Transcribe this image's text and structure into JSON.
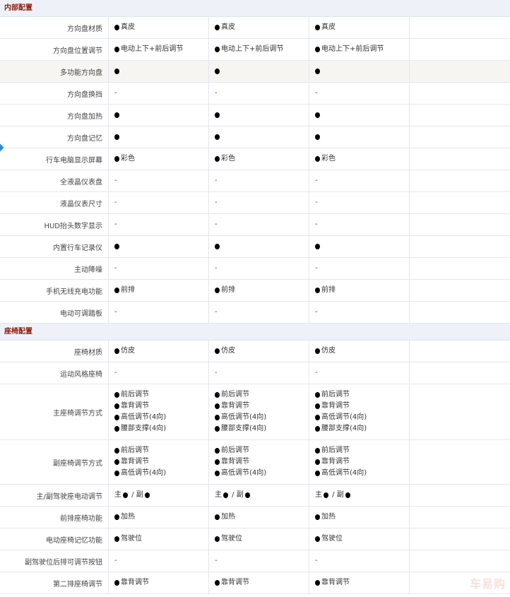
{
  "watermark": "车易购",
  "sections": [
    {
      "title": "内部配置",
      "rows": [
        {
          "label": "方向盘材质",
          "cells": [
            [
              {
                "dot": true,
                "text": "真皮"
              }
            ],
            [
              {
                "dot": true,
                "text": "真皮"
              }
            ],
            [
              {
                "dot": true,
                "text": "真皮"
              }
            ],
            []
          ]
        },
        {
          "label": "方向盘位置调节",
          "cells": [
            [
              {
                "dot": true,
                "text": "电动上下+前后调节"
              }
            ],
            [
              {
                "dot": true,
                "text": "电动上下+前后调节"
              }
            ],
            [
              {
                "dot": true,
                "text": "电动上下+前后调节"
              }
            ],
            []
          ]
        },
        {
          "label": "多功能方向盘",
          "highlight": true,
          "cells": [
            [
              {
                "dot": true,
                "text": ""
              }
            ],
            [
              {
                "dot": true,
                "text": ""
              }
            ],
            [
              {
                "dot": true,
                "text": ""
              }
            ],
            []
          ]
        },
        {
          "label": "方向盘换挡",
          "cells": [
            [
              {
                "dot": false,
                "text": "-"
              }
            ],
            [
              {
                "dot": false,
                "text": "-"
              }
            ],
            [
              {
                "dot": false,
                "text": "-"
              }
            ],
            []
          ]
        },
        {
          "label": "方向盘加热",
          "cells": [
            [
              {
                "dot": true,
                "text": ""
              }
            ],
            [
              {
                "dot": true,
                "text": ""
              }
            ],
            [
              {
                "dot": true,
                "text": ""
              }
            ],
            []
          ]
        },
        {
          "label": "方向盘记忆",
          "cells": [
            [
              {
                "dot": true,
                "text": ""
              }
            ],
            [
              {
                "dot": true,
                "text": ""
              }
            ],
            [
              {
                "dot": true,
                "text": ""
              }
            ],
            []
          ]
        },
        {
          "label": "行车电脑显示屏幕",
          "cells": [
            [
              {
                "dot": true,
                "text": "彩色"
              }
            ],
            [
              {
                "dot": true,
                "text": "彩色"
              }
            ],
            [
              {
                "dot": true,
                "text": "彩色"
              }
            ],
            []
          ]
        },
        {
          "label": "全液晶仪表盘",
          "cells": [
            [
              {
                "dot": false,
                "text": "-"
              }
            ],
            [
              {
                "dot": false,
                "text": "-"
              }
            ],
            [
              {
                "dot": false,
                "text": "-"
              }
            ],
            []
          ]
        },
        {
          "label": "液晶仪表尺寸",
          "cells": [
            [
              {
                "dot": false,
                "text": "-"
              }
            ],
            [
              {
                "dot": false,
                "text": "-"
              }
            ],
            [
              {
                "dot": false,
                "text": "-"
              }
            ],
            []
          ]
        },
        {
          "label": "HUD抬头数字显示",
          "cells": [
            [
              {
                "dot": false,
                "text": "-"
              }
            ],
            [
              {
                "dot": false,
                "text": "-"
              }
            ],
            [
              {
                "dot": false,
                "text": "-"
              }
            ],
            []
          ]
        },
        {
          "label": "内置行车记录仪",
          "cells": [
            [
              {
                "dot": true,
                "text": ""
              }
            ],
            [
              {
                "dot": true,
                "text": ""
              }
            ],
            [
              {
                "dot": true,
                "text": ""
              }
            ],
            []
          ]
        },
        {
          "label": "主动降噪",
          "cells": [
            [
              {
                "dot": false,
                "text": "-"
              }
            ],
            [
              {
                "dot": false,
                "text": "-"
              }
            ],
            [
              {
                "dot": false,
                "text": "-"
              }
            ],
            []
          ]
        },
        {
          "label": "手机无线充电功能",
          "cells": [
            [
              {
                "dot": true,
                "text": "前排"
              }
            ],
            [
              {
                "dot": true,
                "text": "前排"
              }
            ],
            [
              {
                "dot": true,
                "text": "前排"
              }
            ],
            []
          ]
        },
        {
          "label": "电动可调踏板",
          "cells": [
            [
              {
                "dot": false,
                "text": "-"
              }
            ],
            [
              {
                "dot": false,
                "text": "-"
              }
            ],
            [
              {
                "dot": false,
                "text": "-"
              }
            ],
            []
          ]
        }
      ]
    },
    {
      "title": "座椅配置",
      "rows": [
        {
          "label": "座椅材质",
          "cells": [
            [
              {
                "dot": true,
                "text": "仿皮"
              }
            ],
            [
              {
                "dot": true,
                "text": "仿皮"
              }
            ],
            [
              {
                "dot": true,
                "text": "仿皮"
              }
            ],
            []
          ]
        },
        {
          "label": "运动风格座椅",
          "cells": [
            [
              {
                "dot": false,
                "text": "-"
              }
            ],
            [
              {
                "dot": false,
                "text": "-"
              }
            ],
            [
              {
                "dot": false,
                "text": "-"
              }
            ],
            []
          ]
        },
        {
          "label": "主座椅调节方式",
          "height": 79,
          "cells": [
            [
              {
                "dot": true,
                "text": "前后调节"
              },
              {
                "dot": true,
                "text": "靠背调节"
              },
              {
                "dot": true,
                "text": "高低调节(4向)"
              },
              {
                "dot": true,
                "text": "腰部支撑(4向)"
              }
            ],
            [
              {
                "dot": true,
                "text": "前后调节"
              },
              {
                "dot": true,
                "text": "靠背调节"
              },
              {
                "dot": true,
                "text": "高低调节(4向)"
              },
              {
                "dot": true,
                "text": "腰部支撑(4向)"
              }
            ],
            [
              {
                "dot": true,
                "text": "前后调节"
              },
              {
                "dot": true,
                "text": "靠背调节"
              },
              {
                "dot": true,
                "text": "高低调节(4向)"
              },
              {
                "dot": true,
                "text": "腰部支撑(4向)"
              }
            ],
            []
          ]
        },
        {
          "label": "副座椅调节方式",
          "height": 63,
          "cells": [
            [
              {
                "dot": true,
                "text": "前后调节"
              },
              {
                "dot": true,
                "text": "靠背调节"
              },
              {
                "dot": true,
                "text": "高低调节(4向)"
              }
            ],
            [
              {
                "dot": true,
                "text": "前后调节"
              },
              {
                "dot": true,
                "text": "靠背调节"
              },
              {
                "dot": true,
                "text": "高低调节(4向)"
              }
            ],
            [
              {
                "dot": true,
                "text": "前后调节"
              },
              {
                "dot": true,
                "text": "靠背调节"
              },
              {
                "dot": true,
                "text": "高低调节(4向)"
              }
            ],
            []
          ]
        },
        {
          "label": "主/副驾驶座电动调节",
          "cells": [
            [
              {
                "pair": true,
                "a": "主",
                "sep": " / ",
                "b": "副"
              }
            ],
            [
              {
                "pair": true,
                "a": "主",
                "sep": " / ",
                "b": "副"
              }
            ],
            [
              {
                "pair": true,
                "a": "主",
                "sep": " / ",
                "b": "副"
              }
            ],
            []
          ]
        },
        {
          "label": "前排座椅功能",
          "cells": [
            [
              {
                "dot": true,
                "text": "加热"
              }
            ],
            [
              {
                "dot": true,
                "text": "加热"
              }
            ],
            [
              {
                "dot": true,
                "text": "加热"
              }
            ],
            []
          ]
        },
        {
          "label": "电动座椅记忆功能",
          "cells": [
            [
              {
                "dot": true,
                "text": "驾驶位"
              }
            ],
            [
              {
                "dot": true,
                "text": "驾驶位"
              }
            ],
            [
              {
                "dot": true,
                "text": "驾驶位"
              }
            ],
            []
          ]
        },
        {
          "label": "副驾驶位后排可调节按钮",
          "cells": [
            [
              {
                "dot": false,
                "text": "-"
              }
            ],
            [
              {
                "dot": false,
                "text": "-"
              }
            ],
            [
              {
                "dot": false,
                "text": "-"
              }
            ],
            []
          ]
        },
        {
          "label": "第二排座椅调节",
          "cells": [
            [
              {
                "dot": true,
                "text": "靠背调节"
              }
            ],
            [
              {
                "dot": true,
                "text": "靠背调节"
              }
            ],
            [
              {
                "dot": true,
                "text": "靠背调节"
              }
            ],
            []
          ]
        }
      ]
    }
  ]
}
